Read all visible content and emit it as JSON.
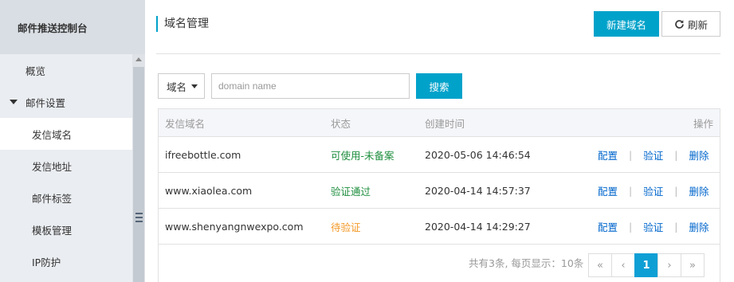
{
  "sidebar": {
    "title": "邮件推送控制台",
    "items": [
      {
        "label": "概览"
      },
      {
        "label": "邮件设置"
      },
      {
        "label": "发信域名"
      },
      {
        "label": "发信地址"
      },
      {
        "label": "邮件标签"
      },
      {
        "label": "模板管理"
      },
      {
        "label": "IP防护"
      }
    ]
  },
  "header": {
    "title": "域名管理",
    "new_domain_label": "新建域名",
    "refresh_label": "刷新"
  },
  "filter": {
    "field_label": "域名",
    "placeholder": "domain name",
    "search_label": "搜索"
  },
  "table": {
    "columns": [
      "发信域名",
      "状态",
      "创建时间",
      "操作"
    ],
    "rows": [
      {
        "domain": "ifreebottle.com",
        "status": "可使用-未备案",
        "created": "2020-05-06 14:46:54",
        "status_color": "#1e8e3e"
      },
      {
        "domain": "www.xiaolea.com",
        "status": "验证通过",
        "created": "2020-04-14 14:57:37",
        "status_color": "#1e8e3e"
      },
      {
        "domain": "www.shenyangnwexpo.com",
        "status": "待验证",
        "created": "2020-04-14 14:29:27",
        "status_color": "#f39826"
      }
    ],
    "actions": {
      "configure": "配置",
      "verify": "验证",
      "delete": "删除"
    }
  },
  "pagination": {
    "summary": "共有3条, 每页显示：10条",
    "first": "«",
    "prev": "‹",
    "current": "1",
    "next": "›",
    "last": "»"
  },
  "colors": {
    "accent": "#00a2ca",
    "pager_active": "#0e9fd5"
  }
}
